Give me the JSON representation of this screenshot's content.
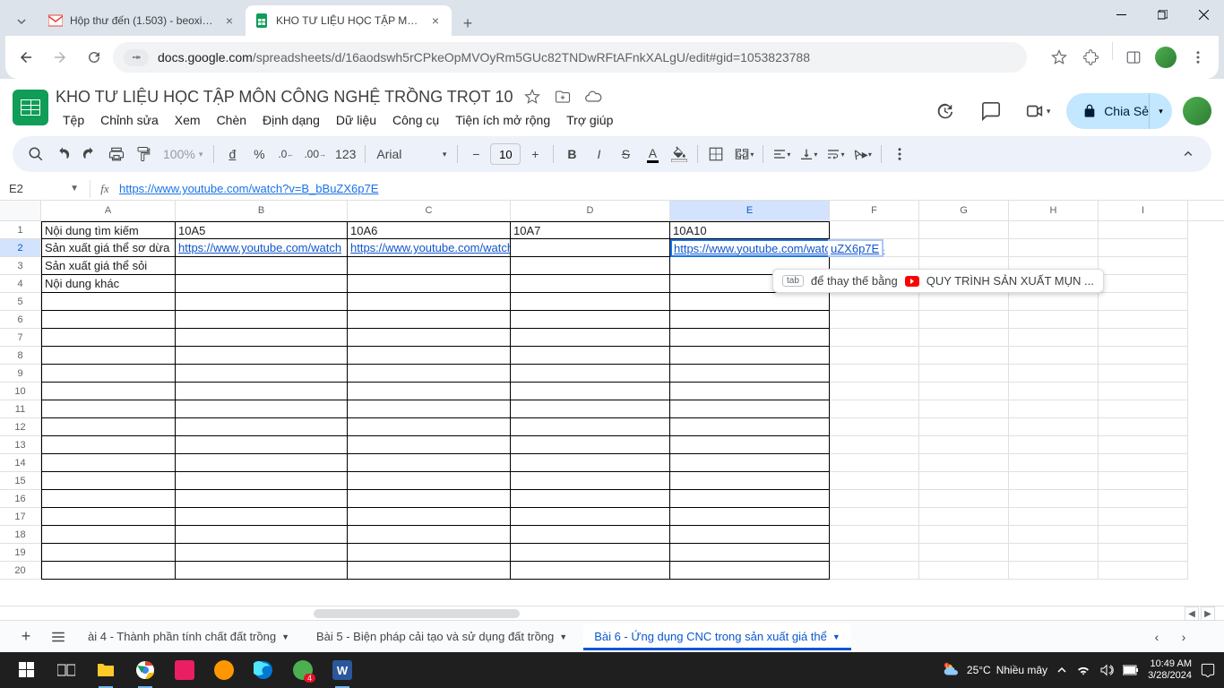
{
  "browser": {
    "tabs": [
      {
        "title": "Hộp thư đến (1.503) - beoxinh.",
        "favicon": "gmail"
      },
      {
        "title": "KHO TƯ LIỆU HỌC TẬP MÔN C",
        "favicon": "sheets"
      }
    ],
    "url_domain": "docs.google.com",
    "url_path": "/spreadsheets/d/16aodswh5rCPkeOpMVOyRm5GUc82TNDwRFtAFnkXALgU/edit#gid=1053823788"
  },
  "doc": {
    "title": "KHO TƯ LIỆU HỌC TẬP MÔN CÔNG NGHỆ TRỒNG TRỌT 10",
    "menus": [
      "Tệp",
      "Chỉnh sửa",
      "Xem",
      "Chèn",
      "Định dạng",
      "Dữ liệu",
      "Công cụ",
      "Tiện ích mở rộng",
      "Trợ giúp"
    ],
    "share": "Chia Sẻ"
  },
  "toolbar": {
    "zoom": "100%",
    "font": "Arial",
    "font_size": "10"
  },
  "fx": {
    "cell": "E2",
    "formula": "https://www.youtube.com/watch?v=B_bBuZX6p7E"
  },
  "columns": [
    "A",
    "B",
    "C",
    "D",
    "E",
    "F",
    "G",
    "H",
    "I"
  ],
  "rows": [
    "1",
    "2",
    "3",
    "4",
    "5",
    "6",
    "7",
    "8",
    "9",
    "10",
    "11",
    "12",
    "13",
    "14",
    "15",
    "16",
    "17",
    "18",
    "19",
    "20"
  ],
  "cells": {
    "A1": "Nội dung tìm kiếm",
    "B1": "10A5",
    "C1": "10A6",
    "D1": "10A7",
    "E1": "10A10",
    "A2": "Sản xuất giá thể sơ dừa",
    "B2": "https://www.youtube.com/watch",
    "C2": "https://www.youtube.com/watch?v=oPEyNoXHiEY",
    "E2": "https://www.youtube.com/watch?v=B_bB",
    "E2_overflow": "uZX6p7E",
    "A3": "Sản xuất giá thể sỏi",
    "A4": "Nội dung khác"
  },
  "suggest": {
    "pre": "để thay thế bằng",
    "text": "QUY TRÌNH SẢN XUẤT MỤN ..."
  },
  "sheet_tabs": {
    "t1": "ài 4 - Thành phần tính chất đất trồng",
    "t2": "Bài 5 - Biện pháp cải tạo và sử dụng đất trồng",
    "t3": "Bài 6 - Ứng dụng CNC trong sản xuất giá thể"
  },
  "tray": {
    "temp": "25°C",
    "weather": "Nhiều mây",
    "time": "10:49 AM",
    "date": "3/28/2024"
  }
}
